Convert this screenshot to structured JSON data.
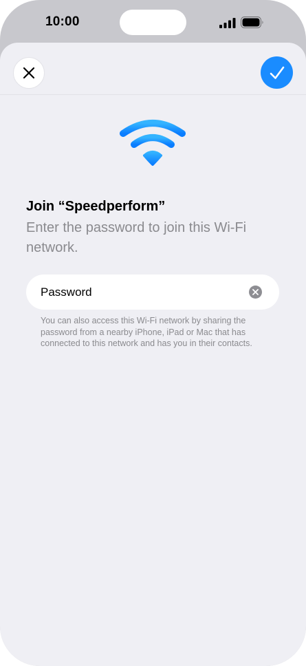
{
  "status_bar": {
    "time": "10:00",
    "icons": [
      "cellular-signal-icon",
      "battery-icon"
    ]
  },
  "nav": {
    "close_icon": "close-icon",
    "confirm_icon": "checkmark-icon"
  },
  "wifi_icon": "wifi-icon",
  "title": "Join “Speedperform”",
  "subtitle": "Enter the password to join this Wi-Fi network.",
  "password_field": {
    "label": "Password",
    "clear_icon": "clear-icon"
  },
  "footnote": "You can also access this Wi-Fi network by sharing the password from a nearby iPhone, iPad or Mac that has connected to this network and has you in their contacts.",
  "colors": {
    "accent": "#1a8cff",
    "background": "#efeff4",
    "secondary_text": "#8a8a8e"
  }
}
